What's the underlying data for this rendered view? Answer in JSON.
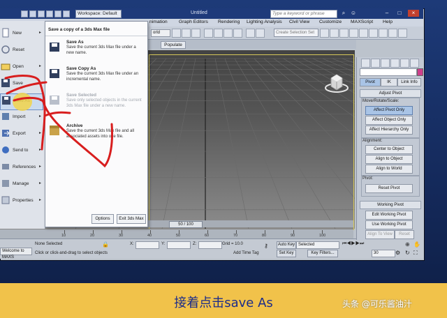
{
  "titlebar": {
    "workspace": "Workspace: Default",
    "doc_title": "Untitled",
    "search_placeholder": "Type a keyword or phrase"
  },
  "menubar": {
    "items": [
      "nimation",
      "Graph Editors",
      "Rendering",
      "Lighting Analysis",
      "Civil View",
      "Customize",
      "MAXScript",
      "Help"
    ]
  },
  "toolbar": {
    "view_dropdown": "orld",
    "selection_set_placeholder": "Create Selection Set"
  },
  "ribbon": {
    "populate_tab": "Populate"
  },
  "file_menu": {
    "left_items": [
      {
        "label": "New",
        "has_arrow": true
      },
      {
        "label": "Reset",
        "has_arrow": false
      },
      {
        "label": "Open",
        "has_arrow": true
      },
      {
        "label": "Save",
        "has_arrow": false
      },
      {
        "label": "Save As",
        "has_arrow": true,
        "highlighted": true
      },
      {
        "label": "Import",
        "has_arrow": true
      },
      {
        "label": "Export",
        "has_arrow": true
      },
      {
        "label": "Send to",
        "has_arrow": true
      },
      {
        "label": "References",
        "has_arrow": true
      },
      {
        "label": "Manage",
        "has_arrow": true
      },
      {
        "label": "Properties",
        "has_arrow": true
      }
    ],
    "submenu_header": "Save a copy of a 3ds Max file",
    "submenu_items": [
      {
        "name": "Save As",
        "desc": "Save the current 3ds Max file under a new name.",
        "disabled": false
      },
      {
        "name": "Save Copy As",
        "desc": "Save the current 3ds Max file under an incremental name.",
        "disabled": false
      },
      {
        "name": "Save Selected",
        "desc": "Save only selected objects in the current 3ds Max file under a new name.",
        "disabled": true
      },
      {
        "name": "Archive",
        "desc": "Save the current 3ds Max file and all associated assets into one file.",
        "disabled": false
      }
    ],
    "options_button": "Options",
    "exit_button": "Exit 3ds Max"
  },
  "timeline": {
    "slider_label": "50 / 100",
    "ticks": [
      "10",
      "20",
      "30",
      "40",
      "50",
      "60",
      "70",
      "80",
      "90",
      "100"
    ]
  },
  "statusbar": {
    "left_label": "Welcome to MAXS",
    "selection_status": "None Selected",
    "prompt": "Click or click-and-drag to select objects",
    "x_label": "X:",
    "y_label": "Y:",
    "z_label": "Z:",
    "grid": "Grid = 10.0",
    "add_time_tag": "Add Time Tag",
    "auto_key": "Auto Key",
    "set_key": "Set Key",
    "key_mode": "Selected",
    "key_filters": "Key Filters...",
    "frame": "30"
  },
  "command_panel": {
    "tabs": [
      "Pivot",
      "IK",
      "Link Info"
    ],
    "adjust_pivot_header": "Adjust Pivot",
    "move_rotate_scale_label": "Move/Rotate/Scale:",
    "pivot_buttons": [
      "Affect Pivot Only",
      "Affect Object Only",
      "Affect Hierarchy Only"
    ],
    "alignment_label": "Alignment:",
    "alignment_buttons": [
      "Center to Object",
      "Align to Object",
      "Align to World"
    ],
    "pivot_label": "Pivot:",
    "reset_pivot": "Reset Pivot",
    "working_pivot_header": "Working Pivot",
    "working_pivot_buttons": [
      "Edit Working Pivot",
      "Use Working Pivot"
    ],
    "align_to_view": "Align To View",
    "reset": "Reset"
  },
  "caption": {
    "text": "接着点击save As",
    "watermark": "头条 @可乐酱油汁"
  },
  "colors": {
    "title_bar": "#1e3a7a",
    "caption_band": "#f1c24a",
    "caption_text": "#1b2c8a",
    "annotation_red": "#d81e1e",
    "highlight_yellow": "#f2d44a"
  }
}
